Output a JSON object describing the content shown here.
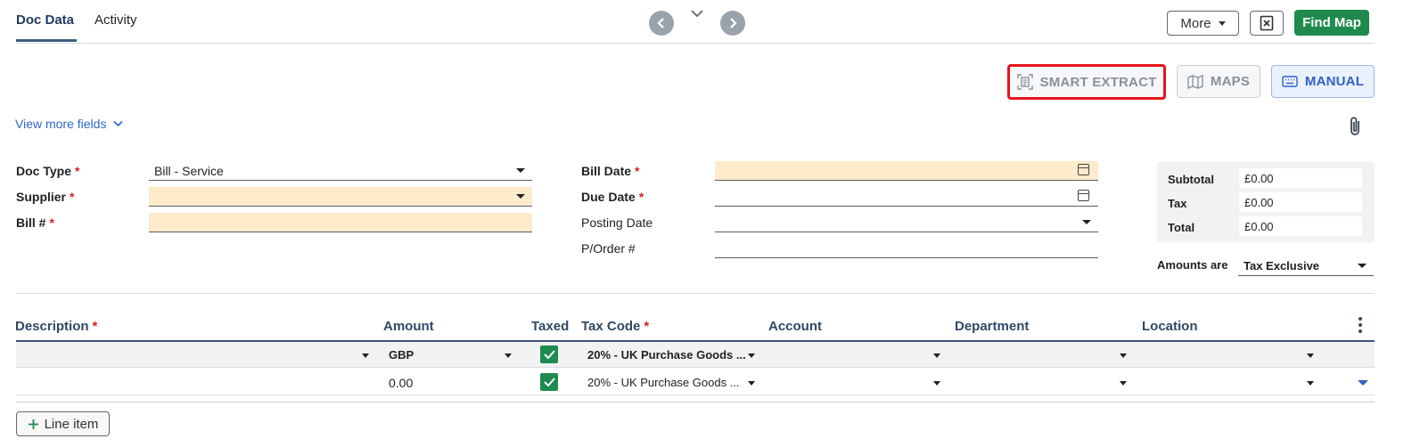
{
  "tabs": [
    {
      "label": "Doc Data",
      "active": true
    },
    {
      "label": "Activity",
      "active": false
    }
  ],
  "nav": {
    "prev_icon": "chevron-left-icon",
    "expand_icon": "chevron-down-icon",
    "next_icon": "chevron-right-icon"
  },
  "toolbar": {
    "more_label": "More",
    "close_icon": "close-document-icon",
    "find_map_label": "Find Map"
  },
  "modes": {
    "smart_extract_label": "SMART EXTRACT",
    "maps_label": "MAPS",
    "manual_label": "MANUAL"
  },
  "view_more_label": "View more fields",
  "form": {
    "doc_type_label": "Doc Type",
    "doc_type_value": "Bill - Service",
    "supplier_label": "Supplier",
    "supplier_value": "",
    "bill_no_label": "Bill #",
    "bill_no_value": "",
    "bill_date_label": "Bill Date",
    "due_date_label": "Due Date",
    "posting_date_label": "Posting Date",
    "porder_label": "P/Order #",
    "required_mark": "*"
  },
  "totals": {
    "subtotal_label": "Subtotal",
    "subtotal_value": "£0.00",
    "tax_label": "Tax",
    "tax_value": "£0.00",
    "total_label": "Total",
    "total_value": "£0.00",
    "amounts_are_label": "Amounts are",
    "amounts_are_value": "Tax Exclusive"
  },
  "grid": {
    "headers": {
      "description": "Description",
      "amount": "Amount",
      "taxed": "Taxed",
      "tax_code": "Tax Code",
      "account": "Account",
      "department": "Department",
      "location": "Location"
    },
    "default_row": {
      "currency": "GBP",
      "tax_code": "20% - UK Purchase Goods ...",
      "taxed": true
    },
    "line_row": {
      "amount": "0.00",
      "tax_code": "20% - UK Purchase Goods ...",
      "taxed": true
    }
  },
  "add_line_label": "Line item",
  "colors": {
    "accent_green": "#1e8a4c",
    "highlight_red": "#e8141c",
    "link_blue": "#2f66c9",
    "required_bg": "#fdebcb"
  }
}
